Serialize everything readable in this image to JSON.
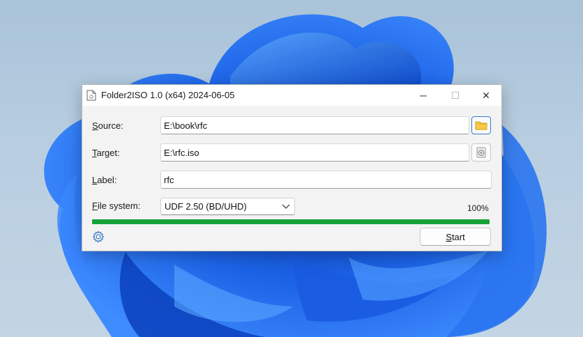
{
  "window": {
    "title": "Folder2ISO 1.0 (x64) 2024-06-05",
    "minimize_glyph": "─",
    "maximize_glyph": "☐",
    "close_glyph": "✕"
  },
  "source": {
    "label_first": "S",
    "label_rest": "ource:",
    "value": "E:\\book\\rfc",
    "button_icon": "folder-icon"
  },
  "target": {
    "label_first": "T",
    "label_rest": "arget:",
    "value": "E:\\rfc.iso",
    "button_icon": "disc-icon"
  },
  "label_field": {
    "label_first": "L",
    "label_rest": "abel:",
    "value": "rfc"
  },
  "filesystem": {
    "label_first": "F",
    "label_rest": "ile system:",
    "selected": "UDF 2.50 (BD/UHD)"
  },
  "progress": {
    "percent_text": "100%",
    "value": 1.0,
    "color": "#16a43a"
  },
  "actions": {
    "settings_icon": "gear-icon",
    "start_first": "S",
    "start_rest": "tart"
  },
  "colors": {
    "accent": "#3a78c9",
    "wallpaper": "#b7cde0",
    "bloom": "#1e5fe0"
  }
}
